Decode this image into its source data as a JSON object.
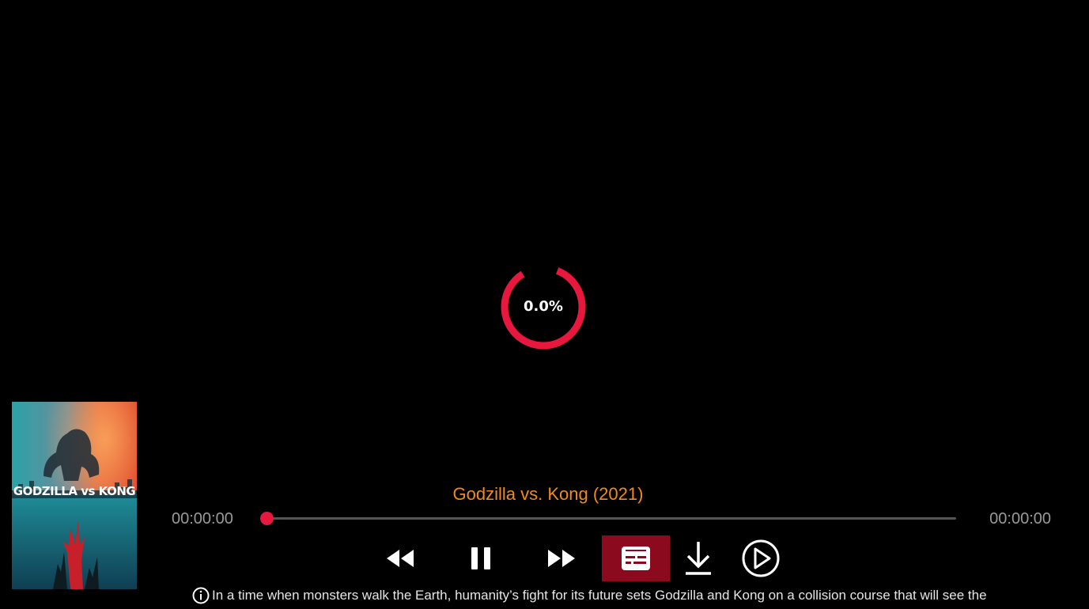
{
  "loader": {
    "progress_text": "0.0%"
  },
  "player": {
    "title": "Godzilla vs. Kong (2021)",
    "current_time": "00:00:00",
    "total_time": "00:00:00",
    "progress_fraction": 0.0,
    "description": "In a time when monsters walk the Earth, humanity’s fight for its future sets Godzilla and Kong on a collision course that will see the"
  },
  "poster": {
    "logo_text": "GODZILLA vs KONG"
  },
  "controls": {
    "rewind": "rewind-icon",
    "pause": "pause-icon",
    "forward": "fast-forward-icon",
    "subtitles": "subtitles-icon",
    "download": "download-icon",
    "next": "play-next-icon"
  },
  "colors": {
    "accent": "#e8173d",
    "title": "#f08a1f",
    "subtitles_bg": "#8b0a1e"
  }
}
